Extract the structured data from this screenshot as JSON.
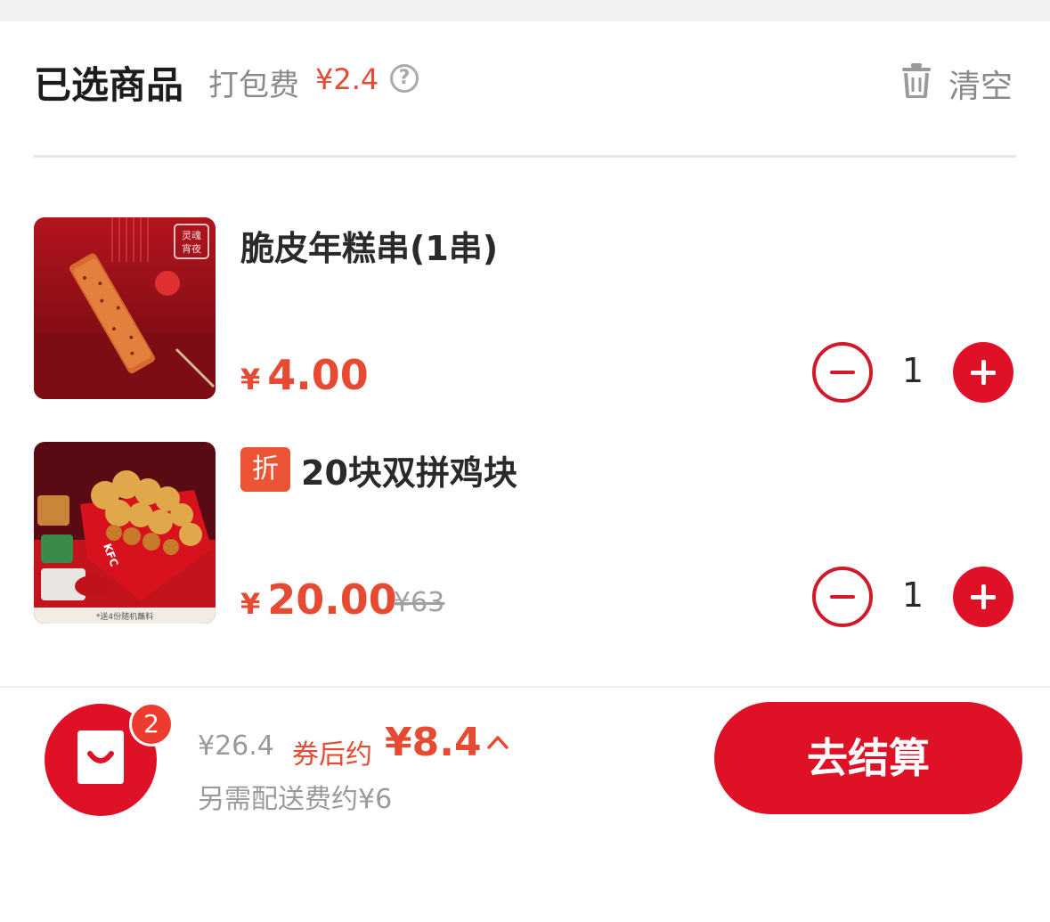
{
  "header": {
    "title": "已选商品",
    "pack_fee_label": "打包费",
    "pack_fee_value": "¥2.4",
    "help_symbol": "?",
    "clear_label": "清空"
  },
  "items": [
    {
      "name": "脆皮年糕串(1串)",
      "currency": "¥",
      "price": "4.00",
      "original_price": "",
      "quantity": "1",
      "tag": "",
      "image_label": "灵魂宵夜"
    },
    {
      "name": "20块双拼鸡块",
      "currency": "¥",
      "price": "20.00",
      "original_price": "¥63",
      "quantity": "1",
      "tag": "折",
      "image_label": "*送4份随机蘸料"
    }
  ],
  "footer": {
    "cart_count": "2",
    "total_original": "¥26.4",
    "coupon_label": "券后约",
    "coupon_price": "¥8.4",
    "delivery_note": "另需配送费约¥6",
    "checkout_label": "去结算"
  },
  "colors": {
    "brand_red": "#df1126",
    "price_red": "#e64a33",
    "muted_gray": "#8a8a8a"
  },
  "icons": [
    "help-icon",
    "trash-icon",
    "minus-icon",
    "plus-icon",
    "shopping-bag-icon",
    "caret-up-icon"
  ]
}
